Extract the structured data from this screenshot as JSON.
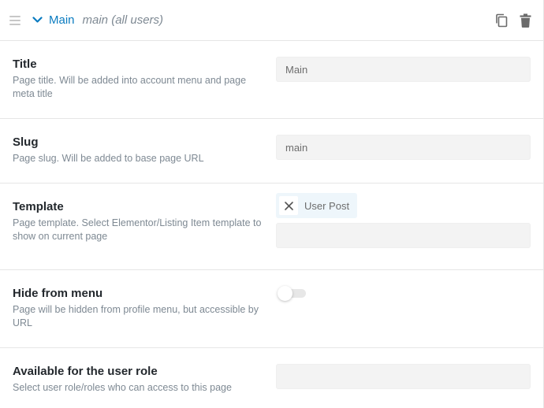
{
  "header": {
    "title": "Main",
    "subtitle": "main (all users)",
    "icons": {
      "drag": "drag-handle-icon",
      "expand": "chevron-down-icon",
      "copy": "copy-icon",
      "delete": "trash-icon"
    },
    "accent_color": "#0a7bc0"
  },
  "fields": {
    "title": {
      "label": "Title",
      "description": "Page title. Will be added into account menu and page meta title",
      "value": "Main"
    },
    "slug": {
      "label": "Slug",
      "description": "Page slug. Will be added to base page URL",
      "value": "main"
    },
    "template": {
      "label": "Template",
      "description": "Page template. Select Elementor/Listing Item template to show on current page",
      "selected": [
        "User Post"
      ]
    },
    "hide_from_menu": {
      "label": "Hide from menu",
      "description": "Page will be hidden from profile menu, but accessible by URL",
      "enabled": false
    },
    "user_role": {
      "label": "Available for the user role",
      "description": "Select user role/roles who can access to this page",
      "selected": []
    }
  }
}
